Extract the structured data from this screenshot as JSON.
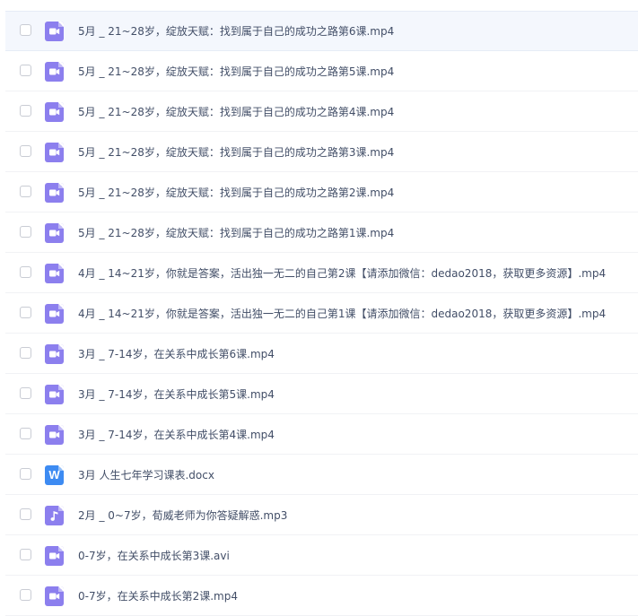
{
  "colors": {
    "video_icon": "#8c7fee",
    "audio_icon": "#8c7fee",
    "doc_icon": "#3d8bf2",
    "text": "#424e67",
    "hover_row": "#f4f7fd",
    "divider": "#f1f2f5"
  },
  "files": [
    {
      "name": "5月 _ 21~28岁，绽放天赋：找到属于自己的成功之路第6课.mp4",
      "type": "video",
      "icon": "video-icon"
    },
    {
      "name": "5月 _ 21~28岁，绽放天赋：找到属于自己的成功之路第5课.mp4",
      "type": "video",
      "icon": "video-icon"
    },
    {
      "name": "5月 _ 21~28岁，绽放天赋：找到属于自己的成功之路第4课.mp4",
      "type": "video",
      "icon": "video-icon"
    },
    {
      "name": "5月 _ 21~28岁，绽放天赋：找到属于自己的成功之路第3课.mp4",
      "type": "video",
      "icon": "video-icon"
    },
    {
      "name": "5月 _ 21~28岁，绽放天赋：找到属于自己的成功之路第2课.mp4",
      "type": "video",
      "icon": "video-icon"
    },
    {
      "name": "5月 _ 21~28岁，绽放天赋：找到属于自己的成功之路第1课.mp4",
      "type": "video",
      "icon": "video-icon"
    },
    {
      "name": "4月 _ 14~21岁，你就是答案，活出独一无二的自己第2课【请添加微信：dedao2018，获取更多资源】.mp4",
      "type": "video",
      "icon": "video-icon"
    },
    {
      "name": "4月 _ 14~21岁，你就是答案，活出独一无二的自己第1课【请添加微信：dedao2018，获取更多资源】.mp4",
      "type": "video",
      "icon": "video-icon"
    },
    {
      "name": "3月 _ 7-14岁，在关系中成长第6课.mp4",
      "type": "video",
      "icon": "video-icon"
    },
    {
      "name": "3月 _ 7-14岁，在关系中成长第5课.mp4",
      "type": "video",
      "icon": "video-icon"
    },
    {
      "name": "3月 _ 7-14岁，在关系中成长第4课.mp4",
      "type": "video",
      "icon": "video-icon"
    },
    {
      "name": "3月 人生七年学习课表.docx",
      "type": "doc",
      "icon": "word-doc-icon",
      "letter": "W"
    },
    {
      "name": "2月 _ 0~7岁，荀威老师为你答疑解惑.mp3",
      "type": "audio",
      "icon": "music-note-icon"
    },
    {
      "name": "0-7岁，在关系中成长第3课.avi",
      "type": "video",
      "icon": "video-icon"
    },
    {
      "name": "0-7岁，在关系中成长第2课.mp4",
      "type": "video",
      "icon": "video-icon"
    }
  ]
}
